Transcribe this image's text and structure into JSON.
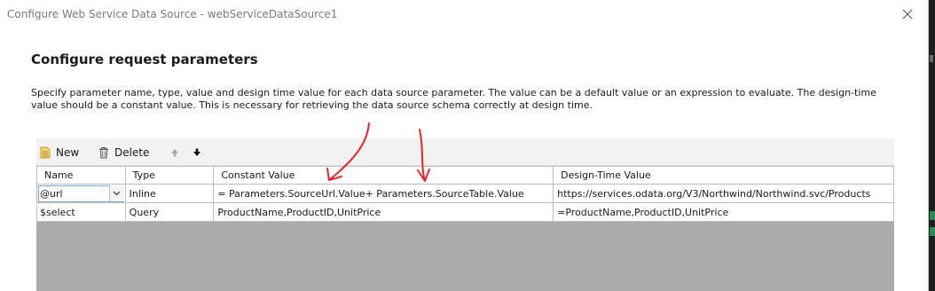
{
  "window": {
    "title": "Configure Web Service Data Source - webServiceDataSource1"
  },
  "page": {
    "heading": "Configure request parameters",
    "description": "Specify parameter name, type, value and design time value for each data source parameter. The value can be a default value or an expression to evaluate. The design-time value should be a constant value. This is necessary for retrieving the data source schema correctly at design time."
  },
  "toolbar": {
    "new_label": "New",
    "delete_label": "Delete"
  },
  "grid": {
    "columns": [
      "Name",
      "Type",
      "Constant Value",
      "Design-Time Value"
    ],
    "rows": [
      {
        "name": "@url",
        "type": "Inline",
        "constant_value": "= Parameters.SourceUrl.Value+ Parameters.SourceTable.Value",
        "design_time_value": "https://services.odata.org/V3/Northwind/Northwind.svc/Products"
      },
      {
        "name": "$select",
        "type": "Query",
        "constant_value": "ProductName,ProductID,UnitPrice",
        "design_time_value": "=ProductName,ProductID,UnitPrice"
      }
    ]
  },
  "colors": {
    "annotation": "#e8252a",
    "panel_empty": "#ababab",
    "title_text": "#7a7a7a"
  },
  "icons": {
    "close": "close-icon",
    "new": "new-document-icon",
    "delete": "trash-icon",
    "move_up": "arrow-up-icon",
    "move_down": "arrow-down-icon",
    "combo": "chevron-down-icon"
  }
}
